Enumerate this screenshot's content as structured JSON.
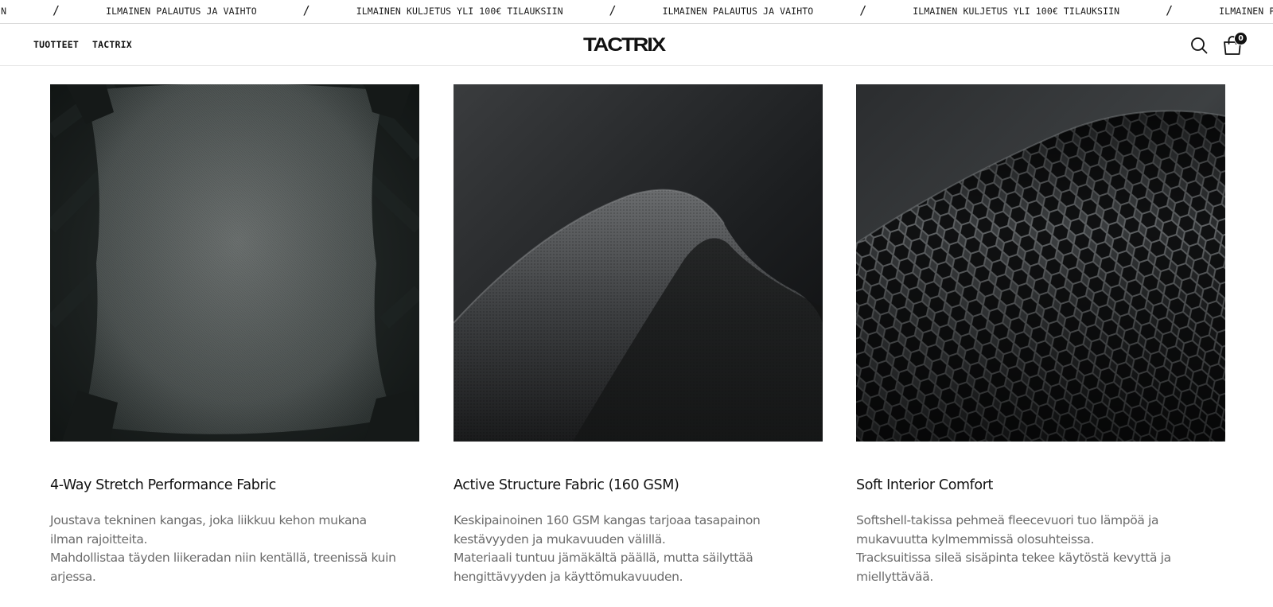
{
  "announcement": {
    "messages": [
      "SIIN",
      "ILMAINEN PALAUTUS JA VAIHTO",
      "ILMAINEN KULJETUS YLI 100€ TILAUKSIIN",
      "ILMAINEN PALAUTUS JA VAIHTO",
      "ILMAINEN KULJETUS YLI 100€ TILAUKSIIN",
      "ILMAINEN PAL"
    ],
    "separator": "/"
  },
  "header": {
    "nav": [
      {
        "label": "TUOTTEET"
      },
      {
        "label": "TACTRIX"
      }
    ],
    "logo": "TACTRIX",
    "cart_count": "0",
    "icons": {
      "search": "search-icon",
      "cart": "shopping-bag-icon"
    }
  },
  "features": [
    {
      "image": "gray-stretch-fabric-photo",
      "title": "4-Way Stretch Performance Fabric",
      "lines": [
        "Joustava tekninen kangas, joka liikkuu kehon mukana ilman rajoitteita.",
        "Mahdollistaa täyden liikeradan niin kentällä, treenissä kuin arjessa."
      ]
    },
    {
      "image": "dark-knit-fabric-fold-photo",
      "title": "Active Structure Fabric (160 GSM)",
      "lines": [
        "Keskipainoinen 160 GSM kangas tarjoaa tasapainon kestävyyden ja mukavuuden välillä.",
        "Materiaali tuntuu jämäkältä päällä, mutta säilyttää hengittävyyden ja käyttömukavuuden."
      ]
    },
    {
      "image": "hexagon-mesh-fabric-photo",
      "title": "Soft Interior Comfort",
      "lines": [
        "Softshell-takissa pehmeä fleecevuori tuo lämpöä ja mukavuutta kylmemmissä olosuhteissa.",
        "Tracksuitissa sileä sisäpinta tekee käytöstä kevyttä ja miellyttävää."
      ]
    }
  ],
  "colors": {
    "text": "#111111",
    "muted_text": "#6b6b6b",
    "border": "#d9d9d9",
    "badge": "#111111"
  }
}
